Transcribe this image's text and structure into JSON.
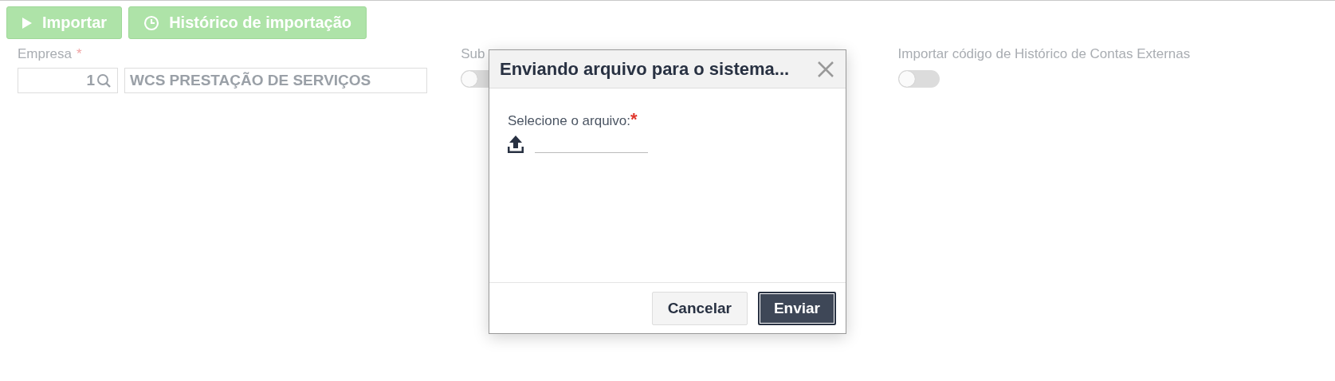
{
  "toolbar": {
    "buttons": [
      {
        "kind": "play",
        "label": "Importar"
      },
      {
        "kind": "history",
        "label": "Histórico de importação"
      }
    ]
  },
  "form": {
    "empresa": {
      "label": "Empresa",
      "required_mark": "*",
      "code": "1",
      "name": "WCS PRESTAÇÃO DE SERVIÇOS"
    },
    "toggles": [
      {
        "label": "Sub",
        "on": false
      },
      {
        "label": "Importar código de Histórico de Contas Externas",
        "on": false
      }
    ]
  },
  "dialog": {
    "title": "Enviando arquivo para o sistema...",
    "field_label": "Selecione o arquivo:",
    "required_mark": "*",
    "buttons": [
      {
        "kind": "secondary",
        "label": "Cancelar"
      },
      {
        "kind": "primary",
        "label": "Enviar"
      }
    ]
  }
}
